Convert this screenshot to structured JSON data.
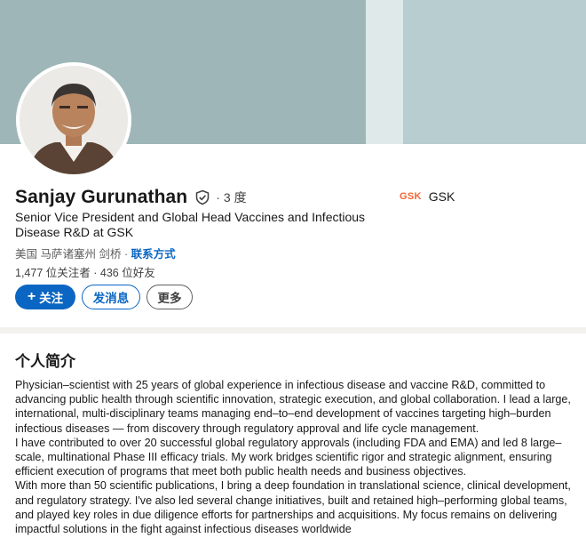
{
  "profile": {
    "name": "Sanjay Gurunathan",
    "degree": "3 度",
    "headline": "Senior Vice President and Global Head Vaccines and Infectious Disease R&D at GSK",
    "location": "美国 马萨诸塞州 剑桥",
    "contact_info": "联系方式",
    "followers": "1,477 位关注者",
    "connections": "436 位好友",
    "company": {
      "logo_text": "GSK",
      "name": "GSK"
    }
  },
  "actions": {
    "follow": "关注",
    "message": "发消息",
    "more": "更多"
  },
  "about": {
    "title": "个人简介",
    "paragraphs": [
      "Physician–scientist with 25 years of global experience in infectious disease and vaccine R&D, committed to advancing public health through scientific innovation, strategic execution, and global collaboration. I lead a large, international, multi-disciplinary teams managing end–to–end development of vaccines targeting high–burden infectious diseases — from discovery through regulatory approval and life cycle management.",
      "I have contributed to over 20 successful global regulatory approvals (including FDA and EMA) and led 8 large–scale, multinational Phase III efficacy trials. My work bridges scientific rigor and strategic alignment, ensuring efficient execution of programs that meet both public health needs and business objectives.",
      "With more than 50 scientific publications, I bring a deep foundation in translational science, clinical development, and regulatory strategy. I've also led several change initiatives, built and retained high–performing global teams, and played key roles in due diligence efforts for partnerships and acquisitions. My focus remains on delivering impactful solutions in the fight against infectious diseases worldwide"
    ]
  },
  "colors": {
    "accent": "#0a66c2",
    "gsk_orange": "#f36633",
    "banner": "#9fb6b8"
  }
}
